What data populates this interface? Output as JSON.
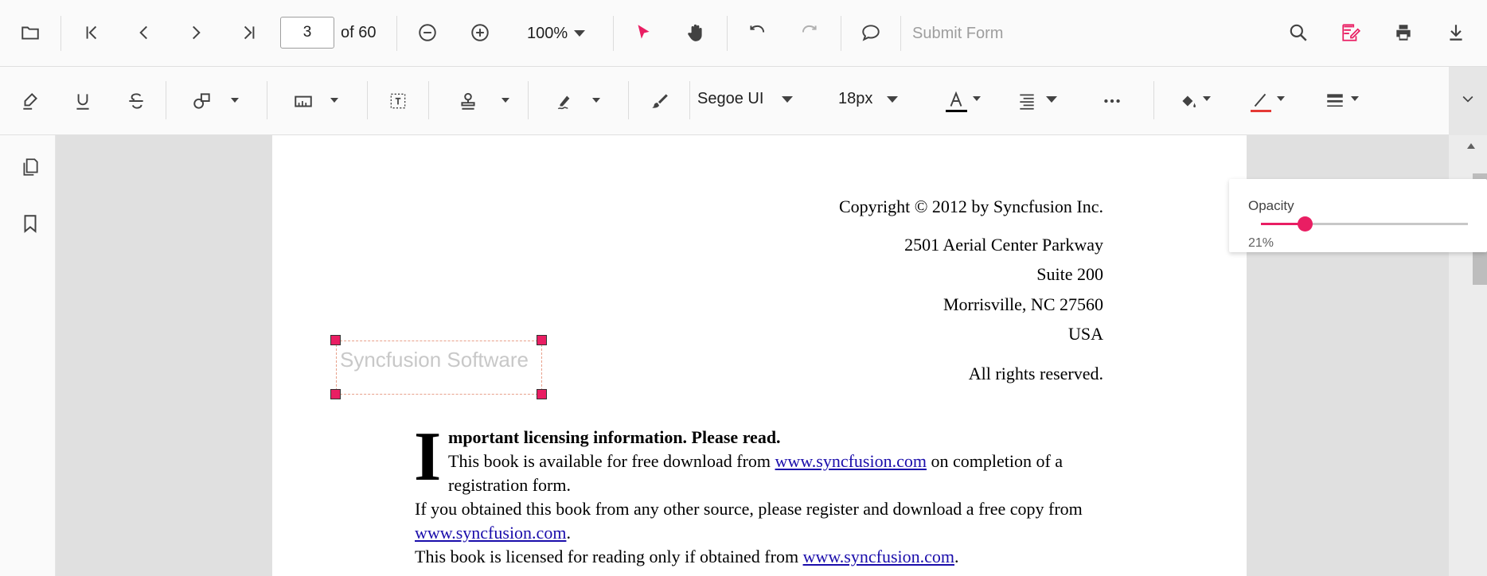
{
  "toolbar": {
    "page_number": "3",
    "page_of": "of 60",
    "zoom": "100%",
    "submit_form": "Submit Form"
  },
  "annotation_toolbar": {
    "font_family": "Segoe UI",
    "font_size": "18px",
    "font_color": "#000000",
    "stroke_color": "#e53935"
  },
  "document": {
    "copyright": "Copyright © 2012 by Syncfusion Inc.",
    "address1": "2501 Aerial Center Parkway",
    "address2": "Suite 200",
    "address3": "Morrisville, NC 27560",
    "address4": "USA",
    "rights": "All rights reserved.",
    "dropcap": "I",
    "heading": "mportant licensing information. Please read.",
    "p1_a": "This book is available for free download from ",
    "p1_link": "www.syncfusion.com",
    "p1_b": " on completion of a",
    "p1_c": "registration form.",
    "p2_a": "If you obtained this book from any other source, please register and download a free copy from",
    "p2_link": "www.syncfusion.com",
    "p2_b": ".",
    "p3_a": "This book is licensed for reading only if obtained from ",
    "p3_link": "www.syncfusion.com",
    "p3_b": ".",
    "free_text_annotation": "Syncfusion Software"
  },
  "opacity_panel": {
    "label": "Opacity",
    "value_text": "21%",
    "value": 0.21
  },
  "colors": {
    "accent": "#e91e63",
    "link": "#1a0dab"
  }
}
